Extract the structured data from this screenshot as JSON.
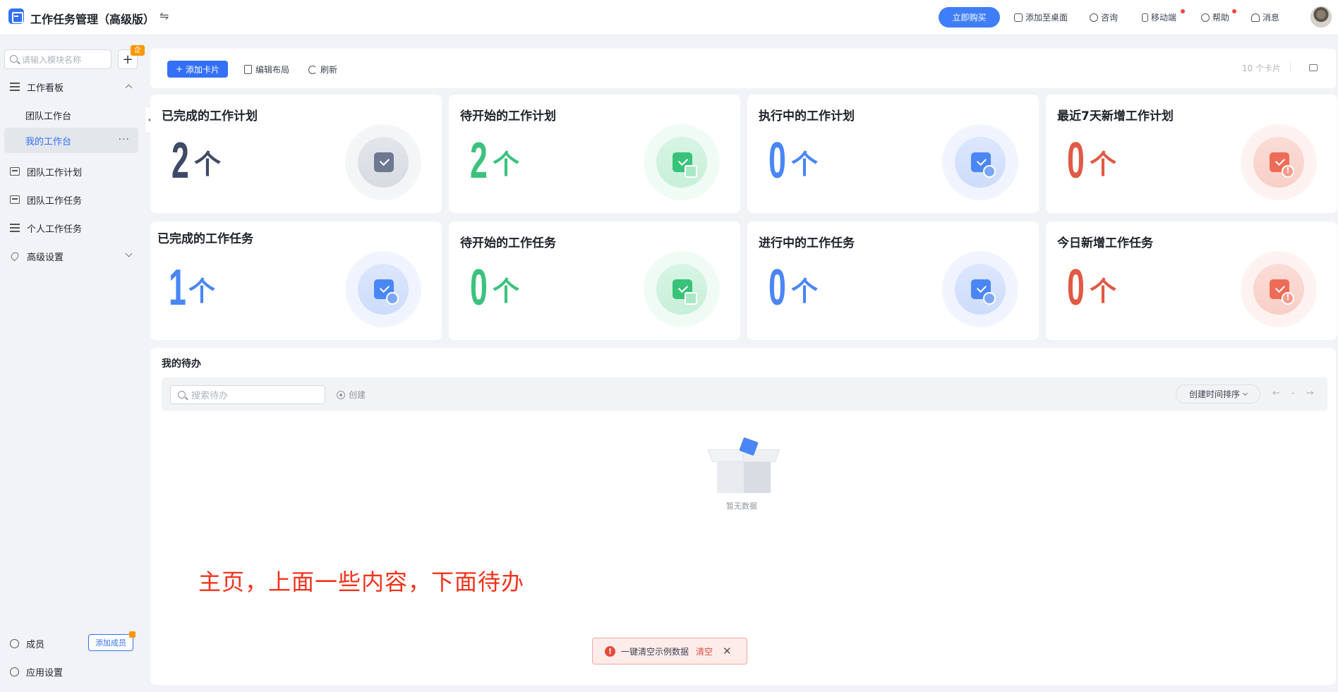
{
  "header": {
    "app_title": "工作任务管理（高级版）",
    "buy_label": "立即购买",
    "items": [
      "添加至桌面",
      "咨询",
      "移动端",
      "帮助",
      "消息"
    ]
  },
  "sidebar": {
    "search_placeholder": "请输入模块名称",
    "enterprise_badge": "企",
    "items": [
      {
        "label": "工作看板"
      },
      {
        "label": "团队工作台"
      },
      {
        "label": "我的工作台"
      },
      {
        "label": "团队工作计划"
      },
      {
        "label": "团队工作任务"
      },
      {
        "label": "个人工作任务"
      },
      {
        "label": "高级设置"
      }
    ],
    "members_label": "成员",
    "add_member_label": "添加成员",
    "app_settings_label": "应用设置"
  },
  "toolbar": {
    "add_card_label": "添加卡片",
    "edit_layout_label": "编辑布局",
    "refresh_label": "刷新",
    "card_count": "10 个卡片"
  },
  "cards": [
    {
      "title": "已完成的工作计划",
      "value": "2",
      "unit": "个",
      "color": "#3e4a66"
    },
    {
      "title": "待开始的工作计划",
      "value": "2",
      "unit": "个",
      "color": "#3cc27e"
    },
    {
      "title": "执行中的工作计划",
      "value": "0",
      "unit": "个",
      "color": "#4a86f5"
    },
    {
      "title": "最近7天新增工作计划",
      "value": "0",
      "unit": "个",
      "color": "#e05a45"
    },
    {
      "title": "已完成的工作任务",
      "value": "1",
      "unit": "个",
      "color": "#4a86f5"
    },
    {
      "title": "待开始的工作任务",
      "value": "0",
      "unit": "个",
      "color": "#3cc27e"
    },
    {
      "title": "进行中的工作任务",
      "value": "0",
      "unit": "个",
      "color": "#4a86f5"
    },
    {
      "title": "今日新增工作任务",
      "value": "0",
      "unit": "个",
      "color": "#e05a45"
    }
  ],
  "todo": {
    "title": "我的待办",
    "search_placeholder": "搜索待办",
    "create_label": "创建",
    "sort_label": "创建时间排序",
    "pager": "← - →",
    "empty_text": "暂无数据"
  },
  "annotation": "主页，上面一些内容，下面待办",
  "toast": {
    "message": "一键清空示例数据",
    "action": "清空"
  }
}
